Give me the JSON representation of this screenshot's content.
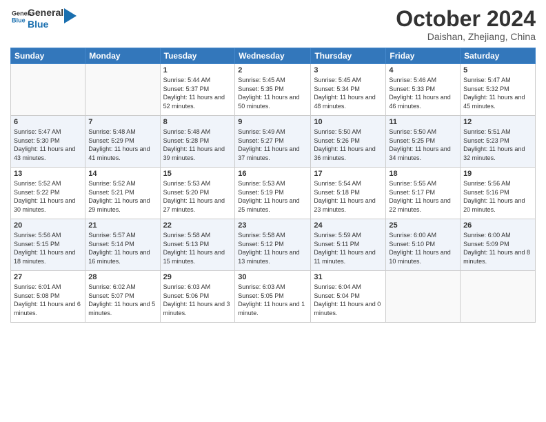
{
  "logo": {
    "general": "General",
    "blue": "Blue"
  },
  "header": {
    "title": "October 2024",
    "location": "Daishan, Zhejiang, China"
  },
  "weekdays": [
    "Sunday",
    "Monday",
    "Tuesday",
    "Wednesday",
    "Thursday",
    "Friday",
    "Saturday"
  ],
  "weeks": [
    [
      {
        "day": "",
        "info": ""
      },
      {
        "day": "",
        "info": ""
      },
      {
        "day": "1",
        "info": "Sunrise: 5:44 AM\nSunset: 5:37 PM\nDaylight: 11 hours and 52 minutes."
      },
      {
        "day": "2",
        "info": "Sunrise: 5:45 AM\nSunset: 5:35 PM\nDaylight: 11 hours and 50 minutes."
      },
      {
        "day": "3",
        "info": "Sunrise: 5:45 AM\nSunset: 5:34 PM\nDaylight: 11 hours and 48 minutes."
      },
      {
        "day": "4",
        "info": "Sunrise: 5:46 AM\nSunset: 5:33 PM\nDaylight: 11 hours and 46 minutes."
      },
      {
        "day": "5",
        "info": "Sunrise: 5:47 AM\nSunset: 5:32 PM\nDaylight: 11 hours and 45 minutes."
      }
    ],
    [
      {
        "day": "6",
        "info": "Sunrise: 5:47 AM\nSunset: 5:30 PM\nDaylight: 11 hours and 43 minutes."
      },
      {
        "day": "7",
        "info": "Sunrise: 5:48 AM\nSunset: 5:29 PM\nDaylight: 11 hours and 41 minutes."
      },
      {
        "day": "8",
        "info": "Sunrise: 5:48 AM\nSunset: 5:28 PM\nDaylight: 11 hours and 39 minutes."
      },
      {
        "day": "9",
        "info": "Sunrise: 5:49 AM\nSunset: 5:27 PM\nDaylight: 11 hours and 37 minutes."
      },
      {
        "day": "10",
        "info": "Sunrise: 5:50 AM\nSunset: 5:26 PM\nDaylight: 11 hours and 36 minutes."
      },
      {
        "day": "11",
        "info": "Sunrise: 5:50 AM\nSunset: 5:25 PM\nDaylight: 11 hours and 34 minutes."
      },
      {
        "day": "12",
        "info": "Sunrise: 5:51 AM\nSunset: 5:23 PM\nDaylight: 11 hours and 32 minutes."
      }
    ],
    [
      {
        "day": "13",
        "info": "Sunrise: 5:52 AM\nSunset: 5:22 PM\nDaylight: 11 hours and 30 minutes."
      },
      {
        "day": "14",
        "info": "Sunrise: 5:52 AM\nSunset: 5:21 PM\nDaylight: 11 hours and 29 minutes."
      },
      {
        "day": "15",
        "info": "Sunrise: 5:53 AM\nSunset: 5:20 PM\nDaylight: 11 hours and 27 minutes."
      },
      {
        "day": "16",
        "info": "Sunrise: 5:53 AM\nSunset: 5:19 PM\nDaylight: 11 hours and 25 minutes."
      },
      {
        "day": "17",
        "info": "Sunrise: 5:54 AM\nSunset: 5:18 PM\nDaylight: 11 hours and 23 minutes."
      },
      {
        "day": "18",
        "info": "Sunrise: 5:55 AM\nSunset: 5:17 PM\nDaylight: 11 hours and 22 minutes."
      },
      {
        "day": "19",
        "info": "Sunrise: 5:56 AM\nSunset: 5:16 PM\nDaylight: 11 hours and 20 minutes."
      }
    ],
    [
      {
        "day": "20",
        "info": "Sunrise: 5:56 AM\nSunset: 5:15 PM\nDaylight: 11 hours and 18 minutes."
      },
      {
        "day": "21",
        "info": "Sunrise: 5:57 AM\nSunset: 5:14 PM\nDaylight: 11 hours and 16 minutes."
      },
      {
        "day": "22",
        "info": "Sunrise: 5:58 AM\nSunset: 5:13 PM\nDaylight: 11 hours and 15 minutes."
      },
      {
        "day": "23",
        "info": "Sunrise: 5:58 AM\nSunset: 5:12 PM\nDaylight: 11 hours and 13 minutes."
      },
      {
        "day": "24",
        "info": "Sunrise: 5:59 AM\nSunset: 5:11 PM\nDaylight: 11 hours and 11 minutes."
      },
      {
        "day": "25",
        "info": "Sunrise: 6:00 AM\nSunset: 5:10 PM\nDaylight: 11 hours and 10 minutes."
      },
      {
        "day": "26",
        "info": "Sunrise: 6:00 AM\nSunset: 5:09 PM\nDaylight: 11 hours and 8 minutes."
      }
    ],
    [
      {
        "day": "27",
        "info": "Sunrise: 6:01 AM\nSunset: 5:08 PM\nDaylight: 11 hours and 6 minutes."
      },
      {
        "day": "28",
        "info": "Sunrise: 6:02 AM\nSunset: 5:07 PM\nDaylight: 11 hours and 5 minutes."
      },
      {
        "day": "29",
        "info": "Sunrise: 6:03 AM\nSunset: 5:06 PM\nDaylight: 11 hours and 3 minutes."
      },
      {
        "day": "30",
        "info": "Sunrise: 6:03 AM\nSunset: 5:05 PM\nDaylight: 11 hours and 1 minute."
      },
      {
        "day": "31",
        "info": "Sunrise: 6:04 AM\nSunset: 5:04 PM\nDaylight: 11 hours and 0 minutes."
      },
      {
        "day": "",
        "info": ""
      },
      {
        "day": "",
        "info": ""
      }
    ]
  ]
}
